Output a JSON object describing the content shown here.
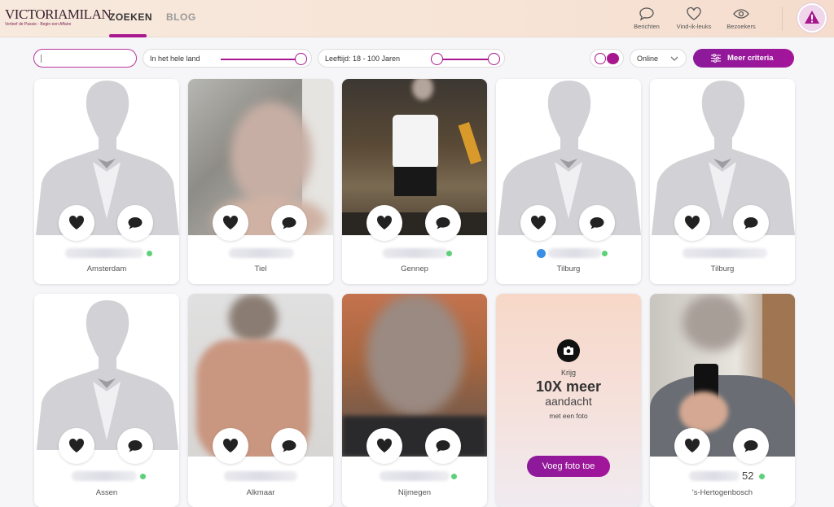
{
  "header": {
    "logo_text": "VICTORIAMILAN",
    "logo_tagline": "Verleef de Passie - Begin een Affaire",
    "tabs": [
      {
        "label": "ZOEKEN"
      },
      {
        "label": "BLOG"
      }
    ],
    "items": [
      {
        "label": "Berichten",
        "icon": "chat-bubble-icon"
      },
      {
        "label": "Vind-ik-leuks",
        "icon": "heart-icon"
      },
      {
        "label": "Bezoekers",
        "icon": "eye-icon"
      }
    ]
  },
  "filters": {
    "search_value": "",
    "location_label": "In het hele land",
    "age_label": "Leeftijd: 18 - 100 Jaren",
    "status_select": "Online",
    "more_button": "Meer criteria"
  },
  "cards": [
    {
      "city": "Amsterdam",
      "online": true,
      "verified": false,
      "placeholder": true
    },
    {
      "city": "Tiel",
      "online": false,
      "verified": false,
      "placeholder": false
    },
    {
      "city": "Gennep",
      "online": true,
      "verified": false,
      "placeholder": false
    },
    {
      "city": "Tilburg",
      "online": true,
      "verified": true,
      "placeholder": true
    },
    {
      "city": "Tilburg",
      "online": false,
      "verified": false,
      "placeholder": true
    },
    {
      "city": "Assen",
      "online": true,
      "verified": false,
      "placeholder": true
    },
    {
      "city": "Alkmaar",
      "online": false,
      "verified": false,
      "placeholder": false
    },
    {
      "city": "Nijmegen",
      "online": true,
      "verified": false,
      "placeholder": false
    },
    {
      "city": "'s-Hertogenbosch",
      "online": true,
      "verified": false,
      "placeholder": false,
      "age": "52"
    }
  ],
  "promo": {
    "line1": "Krijg",
    "line2": "10X meer",
    "line3": "aandacht",
    "line4": "met een foto",
    "button": "Voeg foto toe"
  },
  "colors": {
    "accent": "#a8178d",
    "online": "#5fd07a",
    "verified": "#3a8ee6"
  }
}
